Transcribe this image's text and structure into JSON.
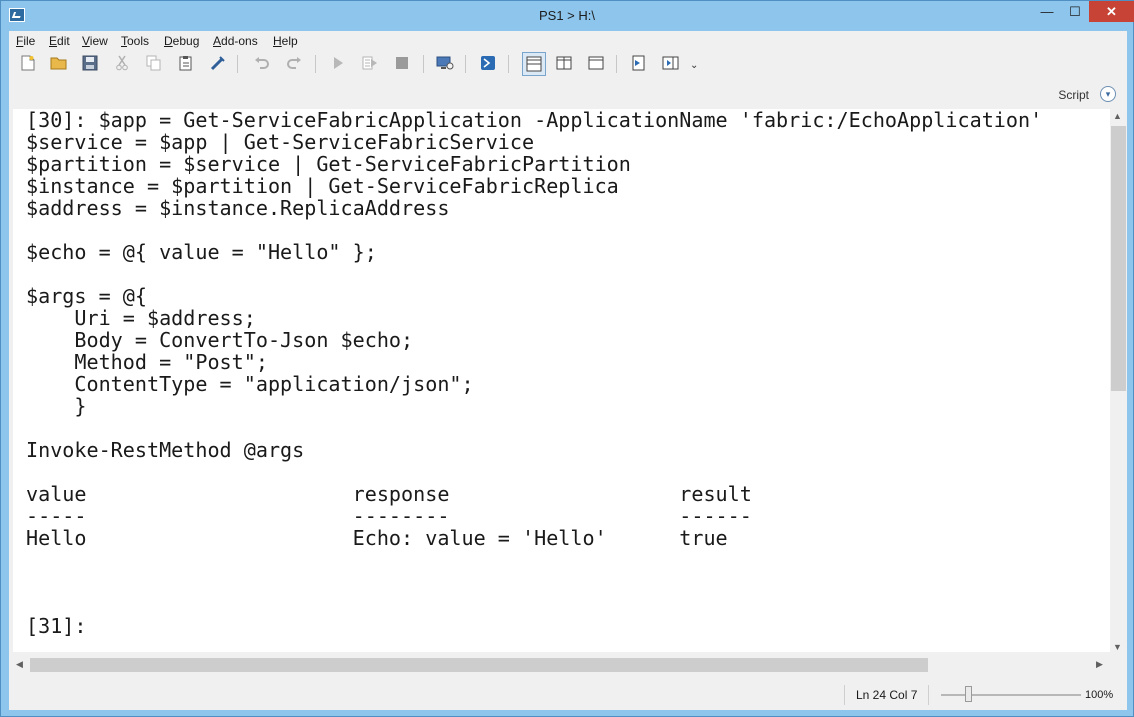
{
  "window": {
    "title": "PS1 > H:\\",
    "minimize": "—",
    "maximize": "☐",
    "close": "✕"
  },
  "menu": [
    "File",
    "Edit",
    "View",
    "Tools",
    "Debug",
    "Add-ons",
    "Help"
  ],
  "menu_mnemonics": [
    "F",
    "E",
    "V",
    "T",
    "D",
    "A",
    "H"
  ],
  "toolbar": {
    "icons": [
      "new-icon",
      "open-icon",
      "save-icon",
      "cut-icon",
      "copy-icon",
      "paste-icon",
      "clear-icon",
      "undo-icon",
      "redo-icon",
      "run-icon",
      "run-selection-icon",
      "stop-icon",
      "remote-tab-icon",
      "powershell-icon",
      "layout-top-icon",
      "layout-right-icon",
      "layout-maximized-icon",
      "show-command-icon",
      "show-addon-icon"
    ],
    "overflow": "⌄"
  },
  "script_pane": {
    "label": "Script",
    "toggle_icon": "chevron-down-icon"
  },
  "console_lines": [
    "[30]: $app = Get-ServiceFabricApplication -ApplicationName 'fabric:/EchoApplication'",
    "$service = $app | Get-ServiceFabricService",
    "$partition = $service | Get-ServiceFabricPartition",
    "$instance = $partition | Get-ServiceFabricReplica",
    "$address = $instance.ReplicaAddress",
    "",
    "$echo = @{ value = \"Hello\" };",
    "",
    "$args = @{",
    "    Uri = $address;",
    "    Body = ConvertTo-Json $echo;",
    "    Method = \"Post\";",
    "    ContentType = \"application/json\";",
    "    }",
    "",
    "Invoke-RestMethod @args",
    "",
    "value                      response                   result",
    "-----                      --------                   ------",
    "Hello                      Echo: value = 'Hello'      true",
    "",
    "",
    "",
    "[31]:"
  ],
  "status": {
    "position": "Ln 24  Col 7",
    "zoom": "100%",
    "zoom_level_fraction": 0.17
  }
}
